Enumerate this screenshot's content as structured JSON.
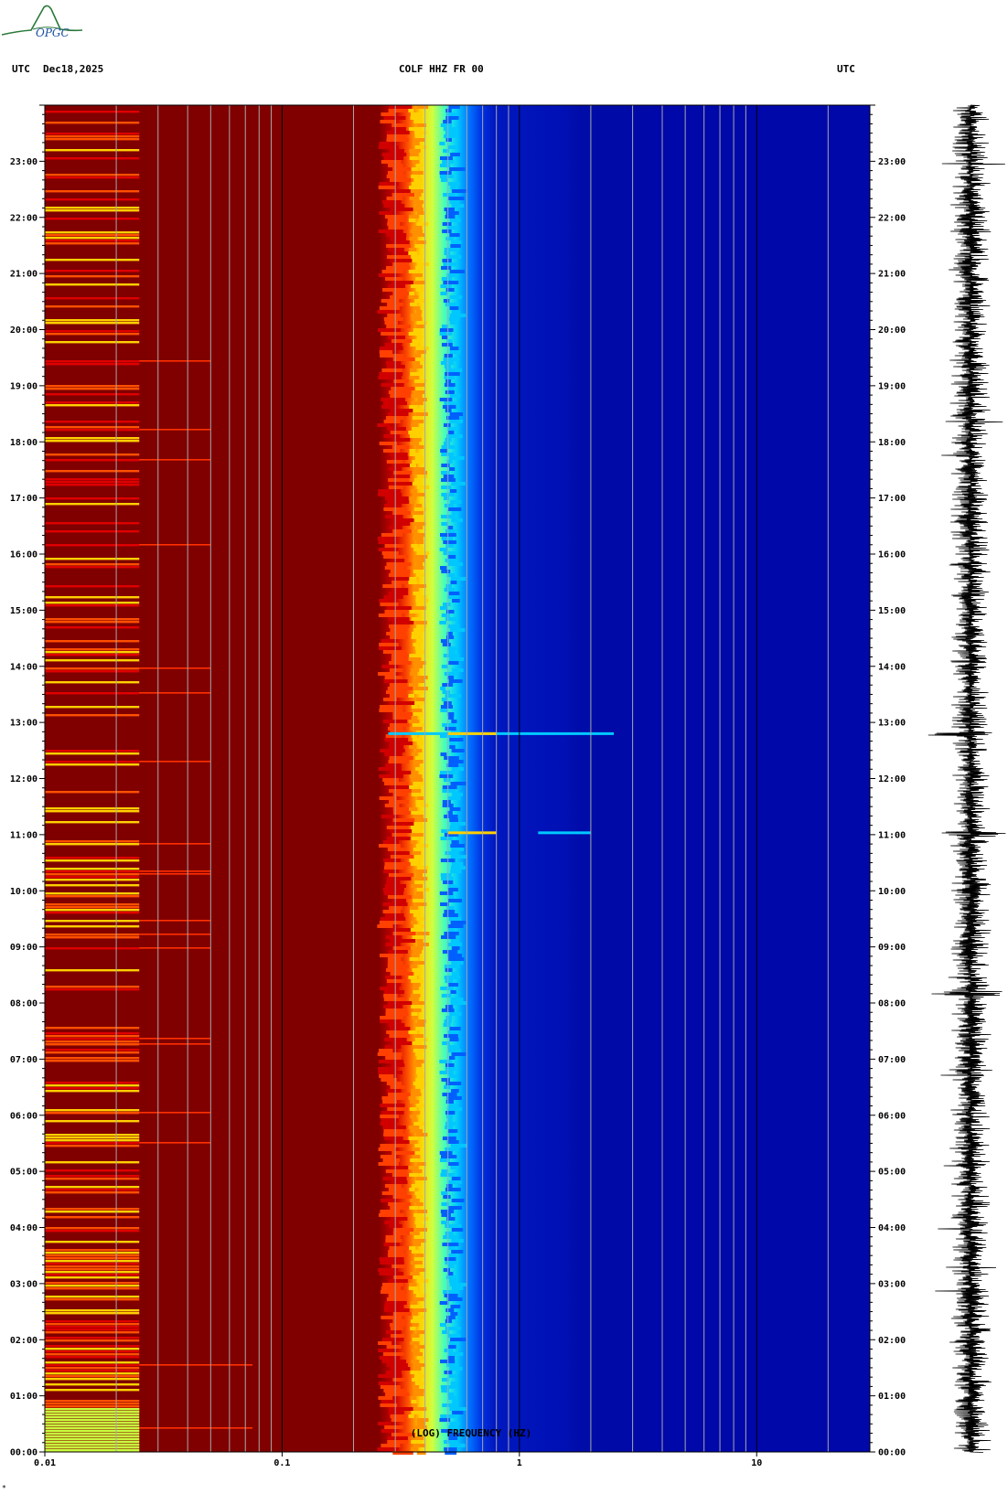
{
  "header": {
    "left_utc": "UTC",
    "date": "Dec18,2025",
    "station": "COLF HHZ FR 00",
    "right_utc": "UTC"
  },
  "logo": {
    "text": "OPGC",
    "color": "#2a7a3a"
  },
  "corner_mark": "*",
  "chart_data": {
    "type": "heatmap",
    "title": "COLF HHZ FR 00",
    "xlabel": "(LOG) FREQUENCY (HZ)",
    "ylabel": "",
    "x_scale": "log",
    "x_range_hz": [
      0.01,
      30
    ],
    "x_ticks": [
      {
        "value": 0.01,
        "label": "0.01"
      },
      {
        "value": 0.1,
        "label": "0.1"
      },
      {
        "value": 1,
        "label": "1"
      },
      {
        "value": 10,
        "label": "10"
      }
    ],
    "y_range_hours": [
      0,
      24
    ],
    "y_ticks": [
      "00:00",
      "01:00",
      "02:00",
      "03:00",
      "04:00",
      "05:00",
      "06:00",
      "07:00",
      "08:00",
      "09:00",
      "10:00",
      "11:00",
      "12:00",
      "13:00",
      "14:00",
      "15:00",
      "16:00",
      "17:00",
      "18:00",
      "19:00",
      "20:00",
      "21:00",
      "22:00",
      "23:00"
    ],
    "grid": true,
    "colormap": [
      "#00007f",
      "#0000c8",
      "#0040ff",
      "#00c0ff",
      "#40ffb0",
      "#c8ff40",
      "#ffd000",
      "#ff6000",
      "#e00000",
      "#800000"
    ],
    "spectral_bands": [
      {
        "hz_from": 0.01,
        "hz_to": 0.025,
        "level": "very high, orange-yellow streaks"
      },
      {
        "hz_from": 0.025,
        "hz_to": 0.28,
        "level": "saturated dark red"
      },
      {
        "hz_from": 0.28,
        "hz_to": 0.45,
        "level": "microseism peak red-yellow"
      },
      {
        "hz_from": 0.45,
        "hz_to": 0.6,
        "level": "cyan-blue transition"
      },
      {
        "hz_from": 0.6,
        "hz_to": 30,
        "level": "low, dark blue"
      }
    ],
    "events": [
      {
        "time_utc": "12:48",
        "hz_from": 0.28,
        "hz_to": 2.5,
        "note": "broadband transient"
      },
      {
        "time_utc": "11:02",
        "hz_from": 1.2,
        "hz_to": 2.0,
        "note": "weak signal"
      }
    ],
    "trace": {
      "type": "seismogram",
      "duration_hours": 24,
      "color": "#000000"
    }
  }
}
